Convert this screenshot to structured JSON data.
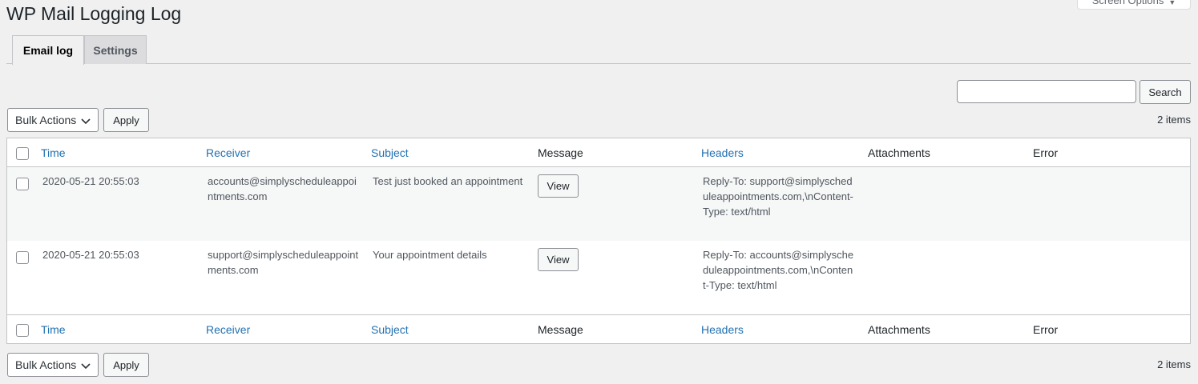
{
  "page": {
    "title": "WP Mail Logging Log",
    "screen_options_label": "Screen Options"
  },
  "tabs": [
    {
      "label": "Email log",
      "active": true
    },
    {
      "label": "Settings",
      "active": false
    }
  ],
  "search": {
    "value": "",
    "placeholder": "",
    "button_label": "Search"
  },
  "bulk_top": {
    "select_label": "Bulk Actions",
    "apply_label": "Apply",
    "count": "2 items"
  },
  "bulk_bottom": {
    "select_label": "Bulk Actions",
    "apply_label": "Apply",
    "count": "2 items"
  },
  "table": {
    "columns": [
      "Time",
      "Receiver",
      "Subject",
      "Message",
      "Headers",
      "Attachments",
      "Error"
    ],
    "rows": [
      {
        "time": "2020-05-21 20:55:03",
        "receiver": "accounts@simplyscheduleappointments.com",
        "subject": "Test just booked an appointment",
        "message_button": "View",
        "headers": "Reply-To: support@simplyscheduleappointments.com,\\nContent-Type: text/html",
        "attachments": "",
        "error": ""
      },
      {
        "time": "2020-05-21 20:55:03",
        "receiver": "support@simplyscheduleappointments.com",
        "subject": "Your appointment details",
        "message_button": "View",
        "headers": "Reply-To: accounts@simplyscheduleappointments.com,\\nContent-Type: text/html",
        "attachments": "",
        "error": ""
      }
    ]
  },
  "colors": {
    "link": "#2271b1",
    "background": "#f0f0f1",
    "border": "#c3c4c7"
  }
}
